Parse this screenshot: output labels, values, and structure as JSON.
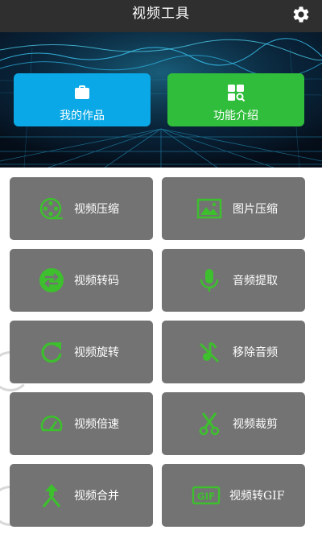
{
  "header": {
    "title": "视频工具",
    "settings_icon": "gear-icon"
  },
  "hero": {
    "buttons": [
      {
        "label": "我的作品",
        "icon": "briefcase-icon",
        "color": "#0aa8e6"
      },
      {
        "label": "功能介绍",
        "icon": "apps-search-icon",
        "color": "#2fbd3b"
      }
    ]
  },
  "tools": [
    {
      "label": "视频压缩",
      "icon": "film-reel-icon"
    },
    {
      "label": "图片压缩",
      "icon": "image-icon"
    },
    {
      "label": "视频转码",
      "icon": "swap-icon"
    },
    {
      "label": "音频提取",
      "icon": "microphone-icon"
    },
    {
      "label": "视频旋转",
      "icon": "rotate-icon"
    },
    {
      "label": "移除音频",
      "icon": "music-off-icon"
    },
    {
      "label": "视频倍速",
      "icon": "speedometer-icon"
    },
    {
      "label": "视频裁剪",
      "icon": "scissors-icon"
    },
    {
      "label": "视频合并",
      "icon": "merge-icon"
    },
    {
      "label": "视频转GIF",
      "icon": "gif-icon"
    }
  ],
  "colors": {
    "accent_green": "#3dbf2e",
    "card_bg": "#737373",
    "topbar_bg": "#2f2f2f"
  }
}
